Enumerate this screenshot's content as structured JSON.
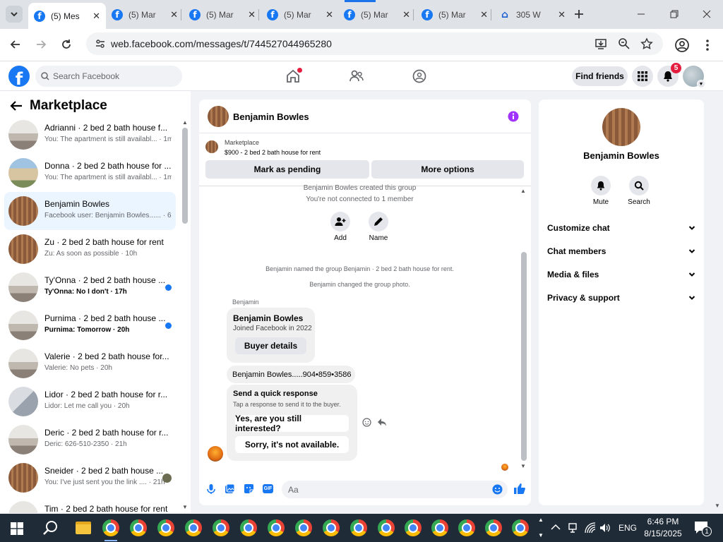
{
  "browser": {
    "tabs": [
      {
        "label": "(5) Mes",
        "icon": "facebook-icon"
      },
      {
        "label": "(5) Mar",
        "icon": "facebook-icon"
      },
      {
        "label": "(5) Mar",
        "icon": "facebook-icon"
      },
      {
        "label": "(5) Mar",
        "icon": "facebook-icon"
      },
      {
        "label": "(5) Mar",
        "icon": "facebook-icon"
      },
      {
        "label": "(5) Mar",
        "icon": "facebook-icon"
      },
      {
        "label": "305 W",
        "icon": "zillow-icon"
      }
    ],
    "url": "web.facebook.com/messages/t/744527044965280"
  },
  "fb": {
    "logo": "f",
    "search_placeholder": "Search Facebook",
    "find_friends": "Find friends",
    "notification_count": "5"
  },
  "sidebar": {
    "title": "Marketplace",
    "conversations": [
      {
        "name": "Adrianni · 2 bed 2 bath house f...",
        "preview": "You: The apartment is still availabl... · 1m"
      },
      {
        "name": "Donna · 2 bed 2 bath house for ...",
        "preview": "You: The apartment is still availabl... · 1m"
      },
      {
        "name": "Benjamin Bowles",
        "preview": "Facebook user: Benjamin Bowles...... · 6h"
      },
      {
        "name": "Zu · 2 bed 2 bath house for rent",
        "preview": "Zu: As soon as possible · 10h"
      },
      {
        "name": "Ty'Onna · 2 bed 2 bath house ...",
        "preview": "Ty'Onna: No I don't · 17h"
      },
      {
        "name": "Purnima · 2 bed 2 bath house ...",
        "preview": "Purnima: Tomorrow · 20h"
      },
      {
        "name": "Valerie · 2 bed 2 bath house for...",
        "preview": "Valerie: No pets · 20h"
      },
      {
        "name": "Lidor · 2 bed 2 bath house for r...",
        "preview": "Lidor: Let me call you · 20h"
      },
      {
        "name": "Deric · 2 bed 2 bath house for r...",
        "preview": "Deric: 626-510-2350 · 21h"
      },
      {
        "name": "Sneider · 2 bed 2 bath house ...",
        "preview": "You: I've just sent you the link .... · 21h"
      },
      {
        "name": "Tim · 2 bed 2 bath house for rent",
        "preview": ""
      }
    ]
  },
  "chat": {
    "header_name": "Benjamin Bowles",
    "marketplace_label": "Marketplace",
    "listing": "$900 - 2 bed 2 bath house for rent",
    "mark_pending": "Mark as pending",
    "more_options": "More options",
    "sys_created": "Benjamin Bowles created this group",
    "sys_not_connected": "You're not connected to 1 member",
    "add_label": "Add",
    "name_label": "Name",
    "sys_named": "Benjamin named the group Benjamin · 2 bed 2 bath house for rent.",
    "sys_photo": "Benjamin changed the group photo.",
    "sender": "Benjamin",
    "card_name": "Benjamin Bowles",
    "card_joined": "Joined Facebook in 2022",
    "buyer_details": "Buyer details",
    "phone_msg": "Benjamin Bowles.....904•859•3586",
    "quick_title": "Send a quick response",
    "quick_sub": "Tap a response to send it to the buyer.",
    "quick_1": "Yes, are you still interested?",
    "quick_2": "Sorry, it's not available.",
    "composer_placeholder": "Aa"
  },
  "profile": {
    "name": "Benjamin Bowles",
    "mute": "Mute",
    "search": "Search",
    "rows": [
      "Customize chat",
      "Chat members",
      "Media & files",
      "Privacy & support"
    ]
  },
  "taskbar": {
    "lang": "ENG",
    "time": "6:46 PM",
    "date": "8/15/2025",
    "notif": "1"
  }
}
